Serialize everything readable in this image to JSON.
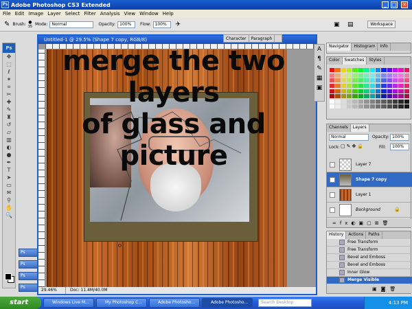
{
  "window": {
    "title": "Adobe Photoshop CS3 Extended",
    "app_icon": "Ps"
  },
  "menu": [
    "File",
    "Edit",
    "Image",
    "Layer",
    "Select",
    "Filter",
    "Analysis",
    "View",
    "Window",
    "Help"
  ],
  "options": {
    "brush_label": "Brush:",
    "brush_size": "35",
    "mode_label": "Mode:",
    "mode_value": "Normal",
    "opacity_label": "Opacity:",
    "opacity_value": "100%",
    "flow_label": "Flow:",
    "flow_value": "100%",
    "workspace_label": "Workspace"
  },
  "tools": {
    "logo": "Ps"
  },
  "document": {
    "title": "Untitled-1 @ 29.5% (Shape 7 copy, RGB/8)",
    "zoom": "29.46%",
    "doc_info": "Doc: 11.4M/40.0M",
    "overlay_text_line1": "merge the two layers",
    "overlay_text_line2": "of glass and picture"
  },
  "minimized_docs": [
    {
      "label": "Ps"
    },
    {
      "label": "Ps"
    },
    {
      "label": "Ps"
    },
    {
      "label": "Ps"
    }
  ],
  "char_panel": {
    "tabs": [
      "Character",
      "Paragraph"
    ]
  },
  "nav_panel": {
    "tabs": [
      "Navigator",
      "Histogram",
      "Info"
    ]
  },
  "swatch_panel": {
    "tabs": [
      "Color",
      "Swatches",
      "Styles"
    ]
  },
  "layers_panel": {
    "tabs": [
      "Channels",
      "Layers"
    ],
    "blend_mode": "Normal",
    "opacity_label": "Opacity:",
    "opacity_value": "100%",
    "lock_label": "Lock:",
    "fill_label": "Fill:",
    "fill_value": "100%",
    "layers": [
      {
        "name": "Layer 7",
        "selected": false
      },
      {
        "name": "Shape 7 copy",
        "selected": true
      },
      {
        "name": "Layer 1",
        "selected": false
      },
      {
        "name": "Background",
        "selected": false
      }
    ]
  },
  "history_panel": {
    "tabs": [
      "History",
      "Actions",
      "Paths"
    ],
    "items": [
      {
        "name": "Free Transform",
        "selected": false
      },
      {
        "name": "Free Transform",
        "selected": false
      },
      {
        "name": "Bevel and Emboss",
        "selected": false
      },
      {
        "name": "Bevel and Emboss",
        "selected": false
      },
      {
        "name": "Inner Glow",
        "selected": false
      },
      {
        "name": "Merge Visible",
        "selected": true
      }
    ]
  },
  "taskbar": {
    "start": "start",
    "buttons": [
      "Windows Live M...",
      "My Photoshop C...",
      "Adobe Photosho...",
      "Adobe Photosho..."
    ],
    "search_placeholder": "Search Desktop",
    "clock": "4:13 PM"
  },
  "colors": {
    "accent": "#316ac5",
    "title_bar": "#0b3fa8",
    "taskbar": "#245edb",
    "start": "#2f8a22"
  }
}
